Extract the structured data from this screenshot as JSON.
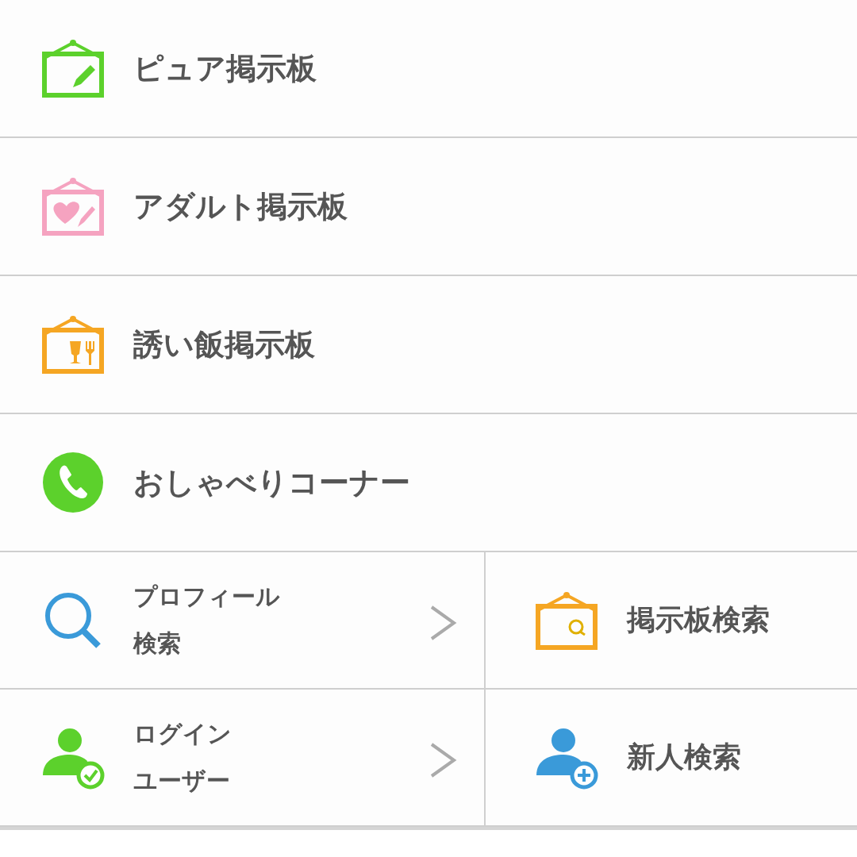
{
  "menu": [
    {
      "label": "ピュア掲示板",
      "kind": "pencil",
      "color": "#5cd12c"
    },
    {
      "label": "アダルト掲示板",
      "kind": "heart",
      "color": "#f5a3c0"
    },
    {
      "label": "誘い飯掲示板",
      "kind": "food",
      "color": "#f5a623"
    },
    {
      "label": "おしゃべりコーナー",
      "kind": "phone",
      "color": "#5cd12c"
    }
  ],
  "grid": [
    {
      "lines": [
        "プロフィール",
        "検索"
      ],
      "kind": "search",
      "color": "#3a9ad9",
      "chevron": true
    },
    {
      "lines": [
        "掲示板検索"
      ],
      "kind": "board",
      "color": "#f5a623",
      "chevron": false
    },
    {
      "lines": [
        "ログイン",
        "ユーザー"
      ],
      "kind": "check",
      "color": "#5cd12c",
      "chevron": true
    },
    {
      "lines": [
        "新人検索"
      ],
      "kind": "plus",
      "color": "#3a9ad9",
      "chevron": false
    }
  ]
}
